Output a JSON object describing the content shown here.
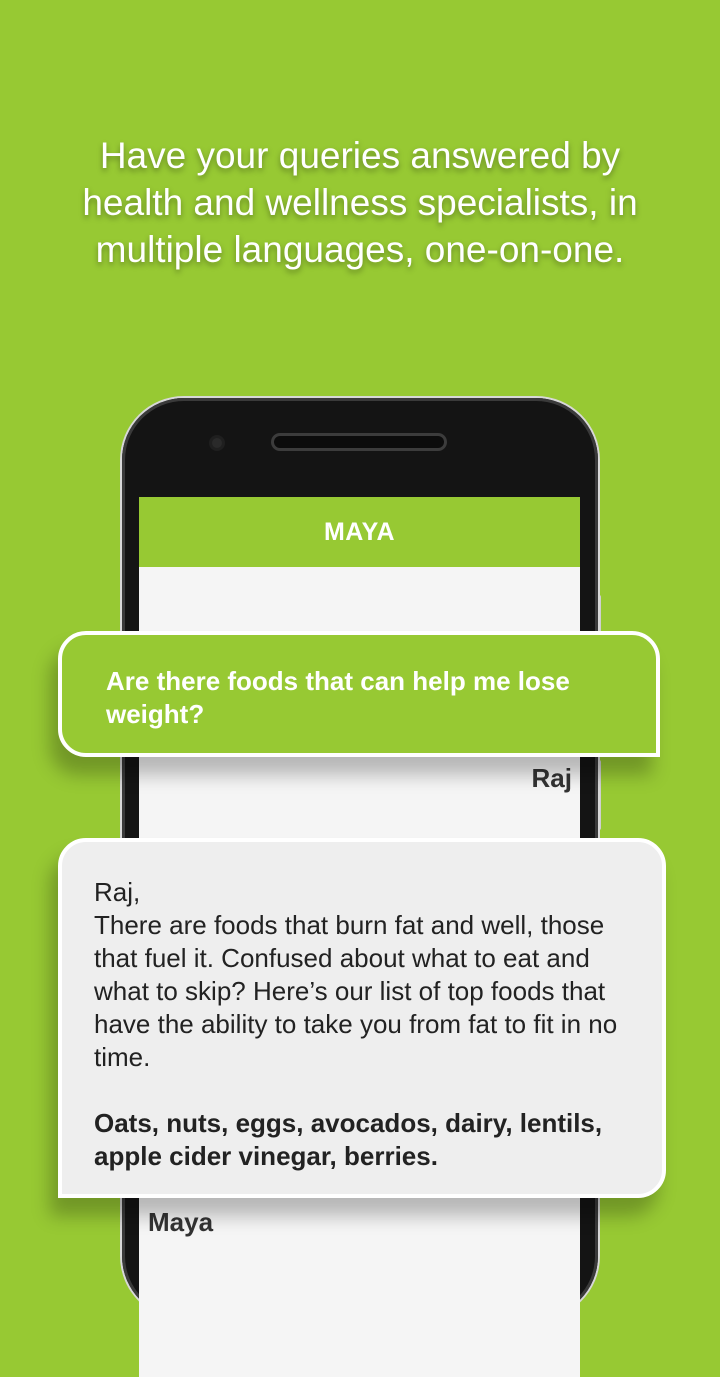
{
  "headline": {
    "line1": "Have your queries answered by",
    "line2": "health and wellness specialists, in",
    "line3": "multiple languages, one-on-one."
  },
  "app": {
    "title": "MAYA"
  },
  "chat": {
    "question": "Are there foods that can help me lose weight?",
    "question_sender": "Raj",
    "answer_greeting": "Raj,",
    "answer_body": "There are foods that burn fat and well, those that fuel it. Confused about what to eat and what to skip? Here’s our list of top foods that have the ability to take you from fat to fit in no time.",
    "answer_list": "Oats, nuts, eggs, avocados, dairy, lentils, apple cider vinegar, berries.",
    "answer_sender": "Maya"
  },
  "colors": {
    "background": "#97c933",
    "accent": "#97c933",
    "answer_bubble": "#eeeeee"
  }
}
